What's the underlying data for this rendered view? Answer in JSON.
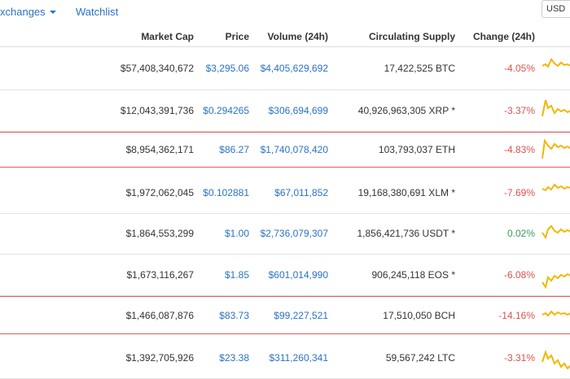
{
  "nav": {
    "exchanges_label": "xchanges",
    "watchlist_label": "Watchlist",
    "currency_label": "USD"
  },
  "table": {
    "headers": {
      "market_cap": "Market Cap",
      "price": "Price",
      "volume": "Volume (24h)",
      "supply": "Circulating Supply",
      "change": "Change (24h)"
    },
    "rows": [
      {
        "market_cap": "$57,408,340,672",
        "price": "$3,295.06",
        "volume": "$4,405,629,692",
        "supply": "17,422,525 BTC",
        "change": "-4.05%"
      },
      {
        "market_cap": "$12,043,391,736",
        "price": "$0.294265",
        "volume": "$306,694,699",
        "supply": "40,926,963,305 XRP *",
        "change": "-3.37%"
      },
      {
        "market_cap": "$8,954,362,171",
        "price": "$86.27",
        "volume": "$1,740,078,420",
        "supply": "103,793,037 ETH",
        "change": "-4.83%"
      },
      {
        "market_cap": "$1,972,062,045",
        "price": "$0.102881",
        "volume": "$67,011,852",
        "supply": "19,168,380,691 XLM *",
        "change": "-7.69%"
      },
      {
        "market_cap": "$1,864,553,299",
        "price": "$1.00",
        "volume": "$2,736,079,307",
        "supply": "1,856,421,736 USDT *",
        "change": "0.02%"
      },
      {
        "market_cap": "$1,673,116,267",
        "price": "$1.85",
        "volume": "$601,014,990",
        "supply": "906,245,118 EOS *",
        "change": "-6.08%"
      },
      {
        "market_cap": "$1,466,087,876",
        "price": "$83.73",
        "volume": "$99,227,521",
        "supply": "17,510,050 BCH",
        "change": "-14.16%"
      },
      {
        "market_cap": "$1,392,705,926",
        "price": "$23.38",
        "volume": "$311,260,341",
        "supply": "59,567,242 LTC",
        "change": "-3.31%"
      }
    ]
  },
  "colors": {
    "link": "#2a72c6",
    "negative": "#d9534f",
    "positive": "#3c9a5c",
    "sparkline": "#f2b705",
    "highlight_border": "#e05a5a"
  }
}
